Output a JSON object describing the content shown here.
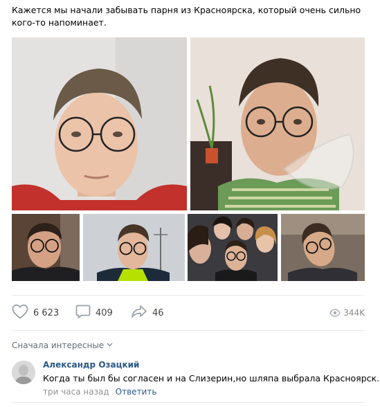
{
  "post": {
    "text": "Кажется мы начали забывать парня из Красноярска, который очень сильно кого-то напоминает."
  },
  "actions": {
    "likes": "6 623",
    "comments": "409",
    "shares": "46",
    "views": "344K"
  },
  "comments_section": {
    "sort_label": "Сначала интересные",
    "items": [
      {
        "author": "Александр Озацкий",
        "text": "Когда ты был бы согласен и на Слизерин,но шляпа выбрала Красноярск.",
        "time": "три часа назад",
        "reply_label": "Ответить"
      }
    ]
  },
  "icons": {
    "like": "heart-icon",
    "comment": "comment-bubble-icon",
    "share": "share-arrow-icon",
    "views": "eye-icon",
    "sort": "chevron-down-icon"
  },
  "colors": {
    "link": "#2a5885",
    "muted": "#939393",
    "icon": "#99a2ad",
    "divider": "#e7e8ec"
  }
}
